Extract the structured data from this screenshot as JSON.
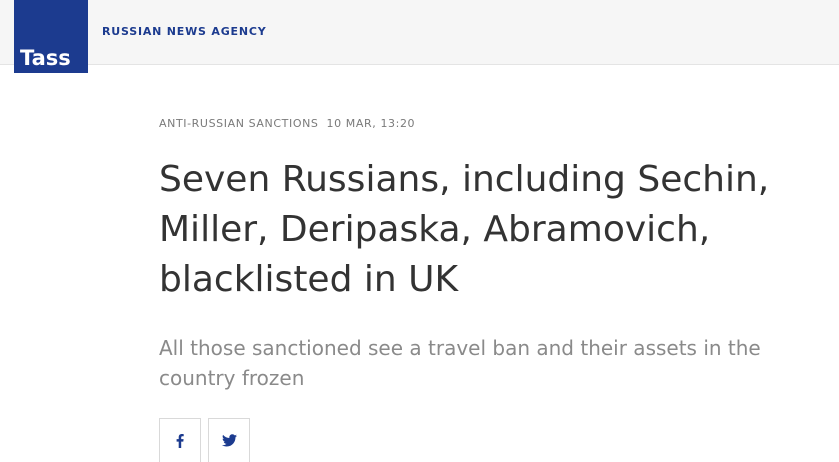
{
  "header": {
    "logo_text": "Tass",
    "agency_label": "RUSSIAN NEWS AGENCY"
  },
  "article": {
    "category": "ANTI-RUSSIAN SANCTIONS",
    "date": "10 MAR, 13:20",
    "title": "Seven Russians, including Sechin, Miller, Deripaska, Abramovich, blacklisted in UK",
    "lead": "All those sanctioned see a travel ban and their assets in the country frozen"
  },
  "share": {
    "buttons": [
      {
        "icon": "facebook-icon"
      },
      {
        "icon": "twitter-icon"
      }
    ]
  },
  "colors": {
    "brand": "#1c3b8f",
    "header_bg": "#f6f6f6",
    "text": "#333333",
    "muted": "#8a8a8a"
  }
}
